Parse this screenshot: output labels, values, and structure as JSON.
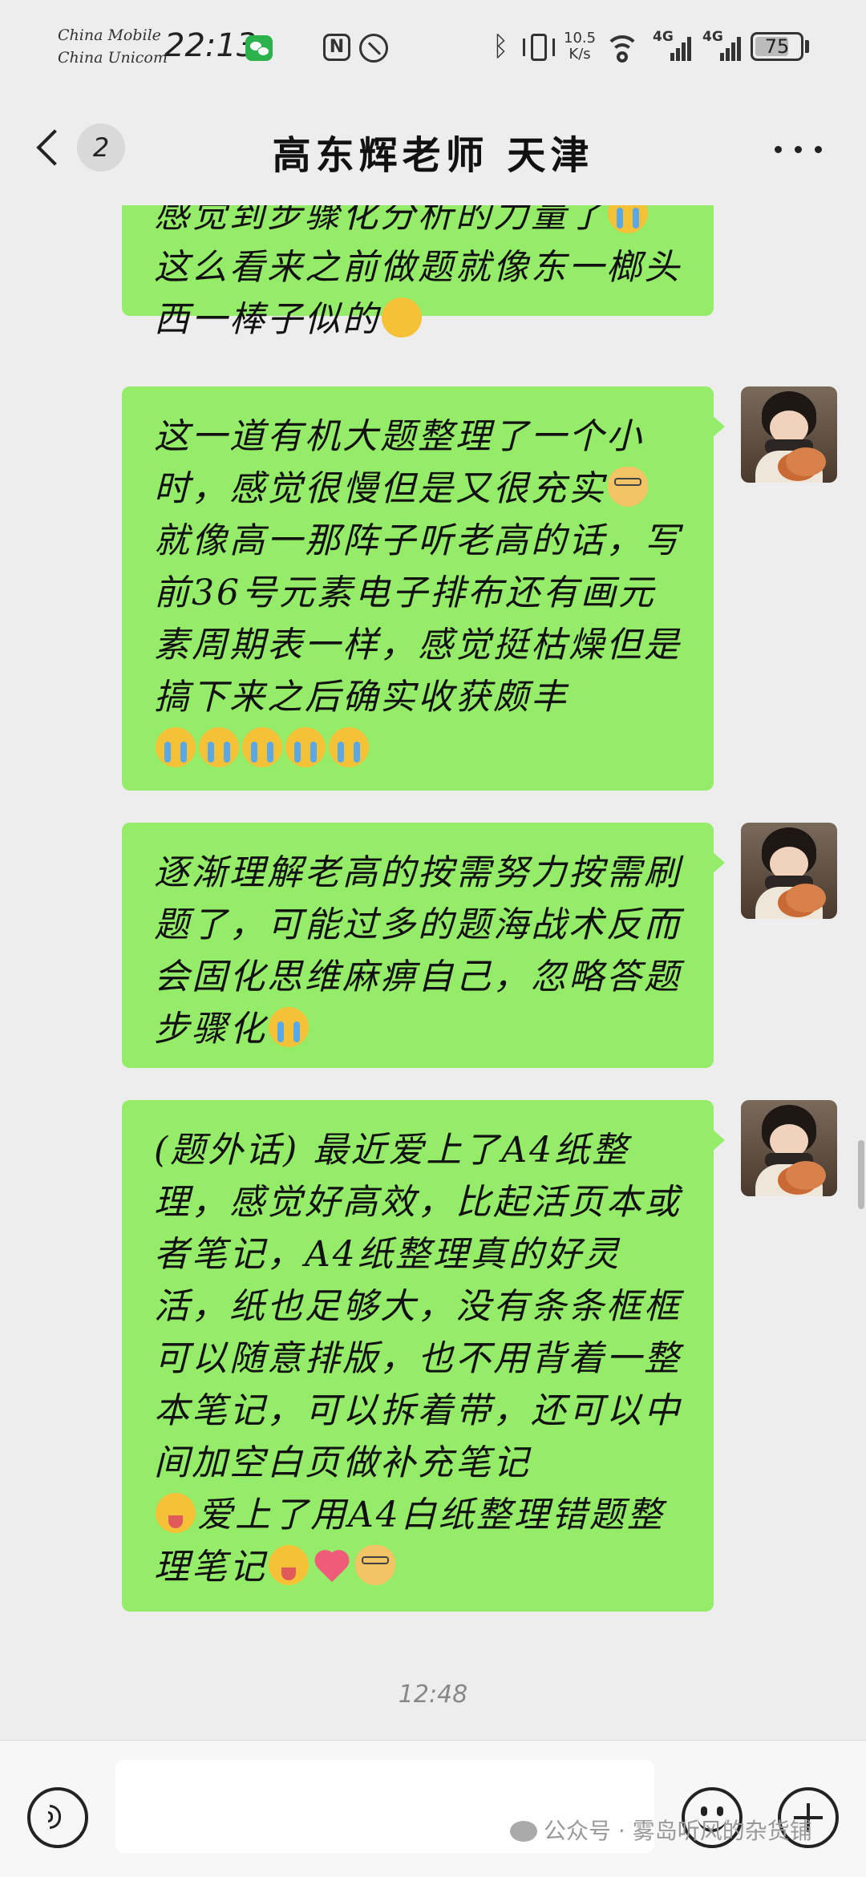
{
  "status_bar": {
    "carrier_1": "China Mobile",
    "carrier_2": "China Unicom",
    "time": "22:13",
    "net_speed_value": "10.5",
    "net_speed_unit": "K/s",
    "signal_1_label": "4G",
    "signal_2_label": "4G",
    "battery_percent": "75",
    "battery_level": 0.75,
    "icons": [
      "wechat-notification-icon",
      "nfc-icon",
      "alarm-icon",
      "bluetooth-icon",
      "vibrate-icon",
      "wifi-icon",
      "signal-icon",
      "battery-icon"
    ]
  },
  "nav": {
    "unread_count": "2",
    "title": "高东辉老师 天津",
    "icons": [
      "back-chevron-icon",
      "more-icon"
    ]
  },
  "messages": [
    {
      "text_1": "感觉到步骤化分析的力量了",
      "text_2": "这么看来之前做题就像东一榔头西一棒子似的",
      "emojis": [
        "cry",
        "sneeze"
      ]
    },
    {
      "text": "这一道有机大题整理了一个小时，感觉很慢但是又很充实",
      "text_2": "就像高一那阵子听老高的话，写前36号元素电子排布还有画元素周期表一样，感觉挺枯燥但是搞下来之后确实收获颇丰",
      "emojis": [
        "dog",
        "cry",
        "cry",
        "cry",
        "cry",
        "cry"
      ]
    },
    {
      "text": "逐渐理解老高的按需努力按需刷题了，可能过多的题海战术反而会固化思维麻痹自己，忽略答题步骤化",
      "emojis": [
        "cry"
      ]
    },
    {
      "text": "(题外话) 最近爱上了A4纸整理，感觉好高效，比起活页本或者笔记，A4纸整理真的好灵活，纸也足够大，没有条条框框可以随意排版，也不用背着一整本笔记，可以拆着带，还可以中间加空白页做补充笔记",
      "text_2": "爱上了用A4白纸整理错题整理笔记",
      "emojis": [
        "tongue",
        "tongue",
        "heart",
        "dog"
      ]
    }
  ],
  "timestamp": "12:48",
  "input_bar": {
    "placeholder": "",
    "icons": [
      "voice-icon",
      "emoji-icon",
      "plus-icon"
    ]
  },
  "watermark": "公众号 · 雾岛听风的杂货铺",
  "colors": {
    "background": "#ededed",
    "bubble": "#95ec69",
    "input_bar": "#f7f7f7"
  }
}
